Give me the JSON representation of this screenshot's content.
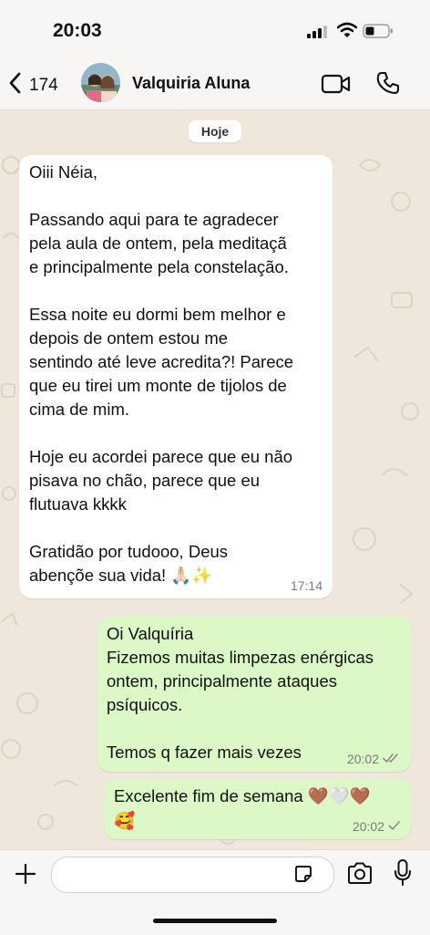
{
  "status_bar": {
    "time": "20:03",
    "signal_icon": "signal-bars-icon",
    "wifi_icon": "wifi-icon",
    "battery_icon": "battery-icon"
  },
  "header": {
    "back_count": "174",
    "contact_name": "Valquiria Aluna",
    "icons": [
      "chevron-left-icon",
      "video-camera-icon",
      "phone-icon"
    ]
  },
  "chat": {
    "date_label": "Hoje",
    "messages": [
      {
        "direction": "incoming",
        "lines": [
          "Oiii Néia,",
          "",
          "Passando aqui para te agradecer",
          "pela aula de ontem, pela meditaçã",
          "e principalmente pela constelação.",
          "",
          "Essa noite eu dormi bem melhor e",
          "depois de ontem estou me",
          "sentindo até leve acredita?! Parece",
          "que eu tirei um monte de tijolos de",
          "cima de mim.",
          "",
          "Hoje eu acordei parece que eu não",
          "pisava no chão, parece que eu",
          "flutuava kkkk",
          "",
          "Gratidão por tudooo, Deus",
          "abençõe sua vida! 🙏🏻✨"
        ],
        "time": "17:14"
      },
      {
        "direction": "outgoing",
        "lines": [
          "Oi Valquíria",
          "Fizemos muitas limpezas enérgicas",
          "ontem, principalmente ataques",
          "psíquicos.",
          "",
          "Temos q fazer mais vezes"
        ],
        "time": "20:02",
        "status": "read-double-check"
      },
      {
        "direction": "outgoing",
        "lines": [
          "Excelente fim de semana 🤎🤍🤎",
          "🥰"
        ],
        "time": "20:02",
        "status": "sent-single-check"
      }
    ]
  },
  "composer": {
    "placeholder": "",
    "icons": [
      "plus-icon",
      "sticker-icon",
      "camera-icon",
      "microphone-icon"
    ]
  }
}
